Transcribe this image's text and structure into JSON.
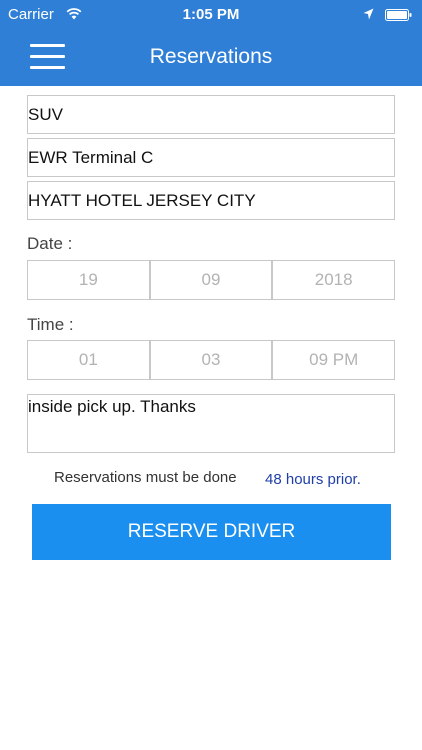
{
  "status_bar": {
    "carrier": "Carrier",
    "time": "1:05 PM"
  },
  "header": {
    "title": "Reservations",
    "background_color": "#2f7fd6"
  },
  "form": {
    "vehicle": "SUV",
    "pickup": "EWR Terminal C",
    "dropoff": "HYATT HOTEL JERSEY CITY",
    "date_label": "Date :",
    "date": {
      "day": "19",
      "month": "09",
      "year": "2018"
    },
    "time_label": "Time :",
    "time": {
      "hour": "01",
      "minute": "03",
      "period": "09 PM"
    },
    "notes": "inside pick up. Thanks"
  },
  "notice": {
    "text": "Reservations must be done",
    "highlight": "48 hours prior."
  },
  "reserve_button": {
    "label": "RESERVE DRIVER",
    "color": "#1a8ff0"
  }
}
